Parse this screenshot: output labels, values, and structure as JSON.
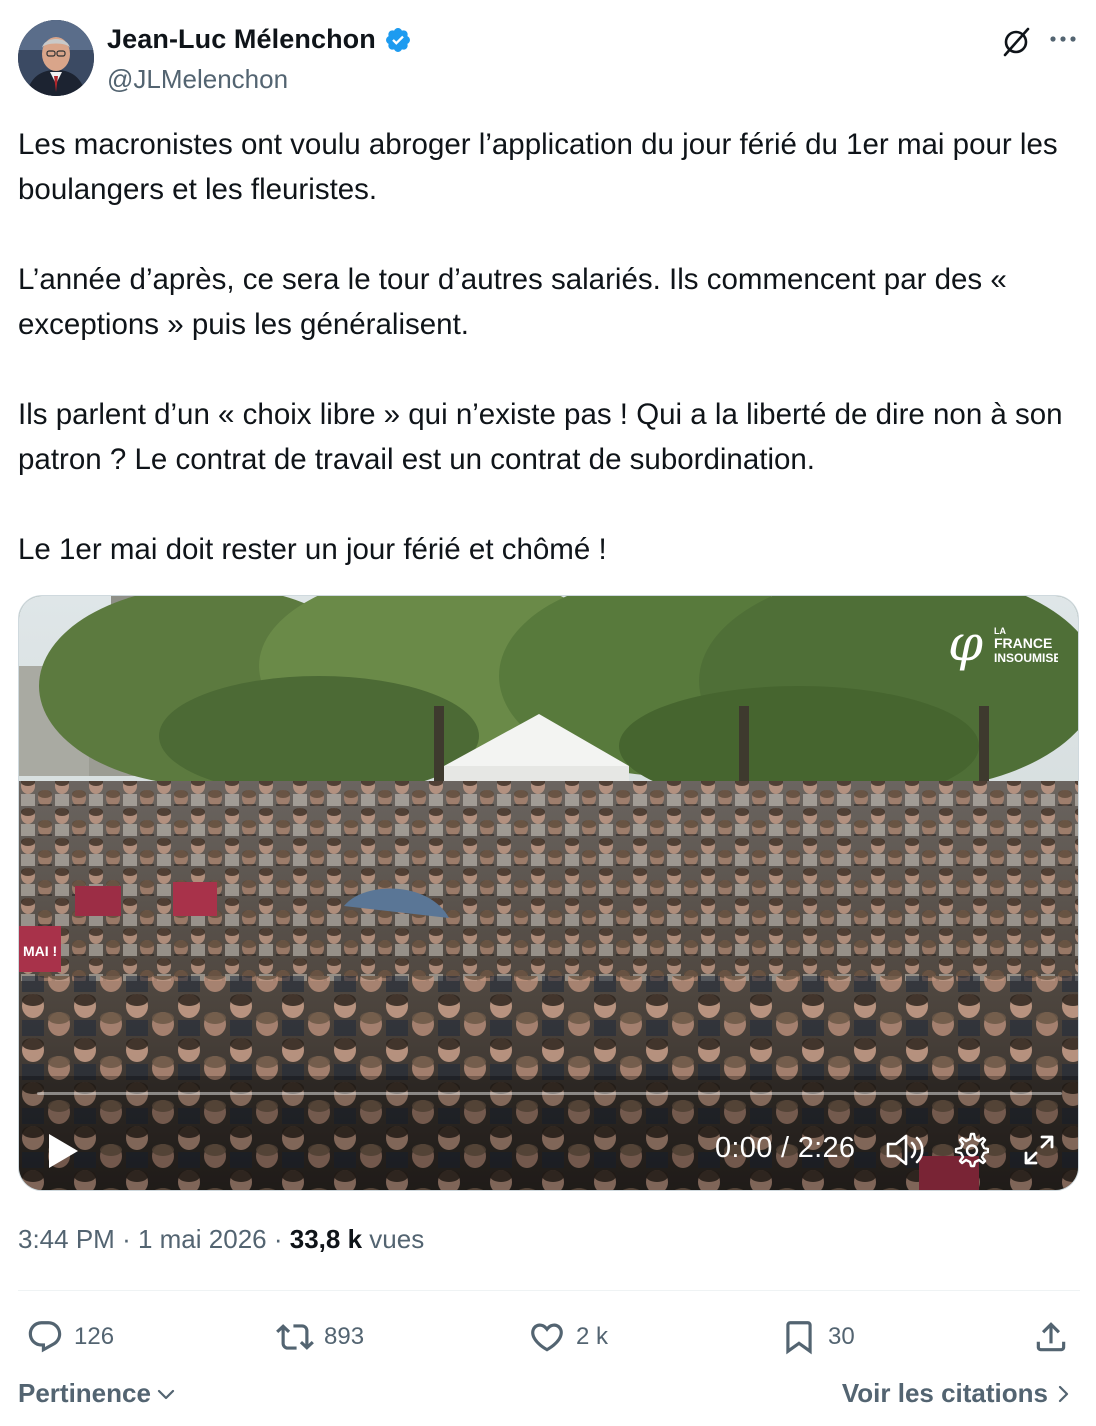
{
  "author": {
    "display_name": "Jean-Luc Mélenchon",
    "handle": "@JLMelenchon",
    "verified": true,
    "verified_color": "#1d9bf0"
  },
  "header_icons": [
    "grok-icon",
    "more-icon"
  ],
  "tweet": {
    "paragraphs": [
      "Les macronistes ont voulu abroger l’application du jour férié du 1er mai pour les boulangers et les fleuristes.",
      "L’année d’après, ce sera le tour d’autres salariés. Ils commencent par des « exceptions » puis les généralisent.",
      "Ils parlent d’un « choix libre » qui n’existe pas ! Qui a la liberté de dire non à son patron ? Le contrat de travail est un contrat de subordination.",
      "Le 1er mai doit rester un jour férié et chômé !"
    ]
  },
  "video": {
    "time_display": "0:00 / 2:26",
    "progress": 0,
    "logo_text": [
      "LA",
      "FRANCE",
      "INSOUMISE"
    ],
    "sign_text": "MAI !",
    "controls": [
      "play-icon",
      "volume-icon",
      "settings-icon",
      "fullscreen-icon"
    ]
  },
  "meta": {
    "time": "3:44 PM",
    "separator": "·",
    "date": "1 mai 2026",
    "views_count": "33,8 k",
    "views_label": "vues"
  },
  "actions": {
    "replies": "126",
    "reposts": "893",
    "likes": "2 k",
    "bookmarks": "30"
  },
  "footer": {
    "sort_label": "Pertinence",
    "quotes_label": "Voir les citations"
  },
  "colors": {
    "text": "#0f1419",
    "secondary": "#536471",
    "divider": "#eff3f4"
  }
}
